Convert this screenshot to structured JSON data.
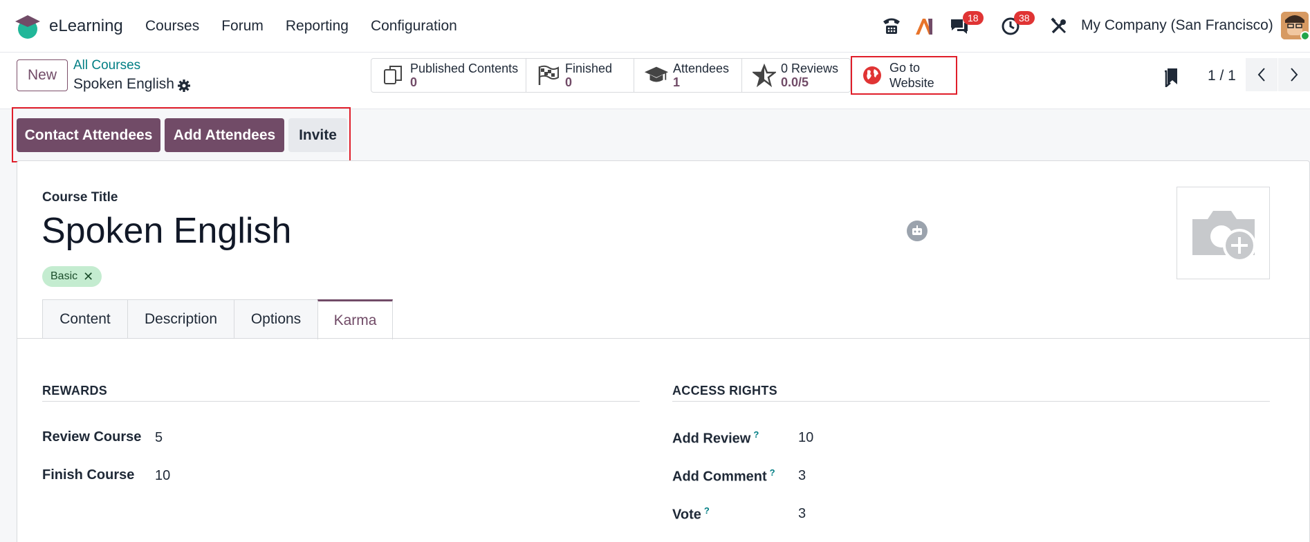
{
  "app": {
    "name": "eLearning"
  },
  "menu": [
    "Courses",
    "Forum",
    "Reporting",
    "Configuration"
  ],
  "systray": {
    "chat_count": "18",
    "activity_count": "38",
    "company": "My Company (San Francisco)"
  },
  "control_panel": {
    "new_label": "New",
    "breadcrumb_parent": "All Courses",
    "breadcrumb_current": "Spoken English",
    "stats": [
      {
        "label": "Published Contents",
        "value": "0"
      },
      {
        "label": "Finished",
        "value": "0"
      },
      {
        "label": "Attendees",
        "value": "1"
      },
      {
        "label": "0 Reviews",
        "value": "0.0/5"
      }
    ],
    "go_to_website_line1": "Go to",
    "go_to_website_line2": "Website",
    "pager": "1 / 1"
  },
  "actions": {
    "contact": "Contact Attendees",
    "add": "Add Attendees",
    "invite": "Invite"
  },
  "form": {
    "course_title_label": "Course Title",
    "course_title": "Spoken English",
    "tag": "Basic",
    "tabs": [
      "Content",
      "Description",
      "Options",
      "Karma"
    ],
    "active_tab": "Karma",
    "rewards": {
      "title": "REWARDS",
      "review_course_label": "Review Course",
      "review_course_value": "5",
      "finish_course_label": "Finish Course",
      "finish_course_value": "10"
    },
    "access": {
      "title": "ACCESS RIGHTS",
      "add_review_label": "Add Review",
      "add_review_value": "10",
      "add_comment_label": "Add Comment",
      "add_comment_value": "3",
      "vote_label": "Vote",
      "vote_value": "3",
      "help_mark": "?"
    }
  },
  "colors": {
    "brand": "#714b67",
    "link": "#017e84",
    "highlight": "#e01e2a",
    "tag_bg": "#c4ecd0"
  }
}
